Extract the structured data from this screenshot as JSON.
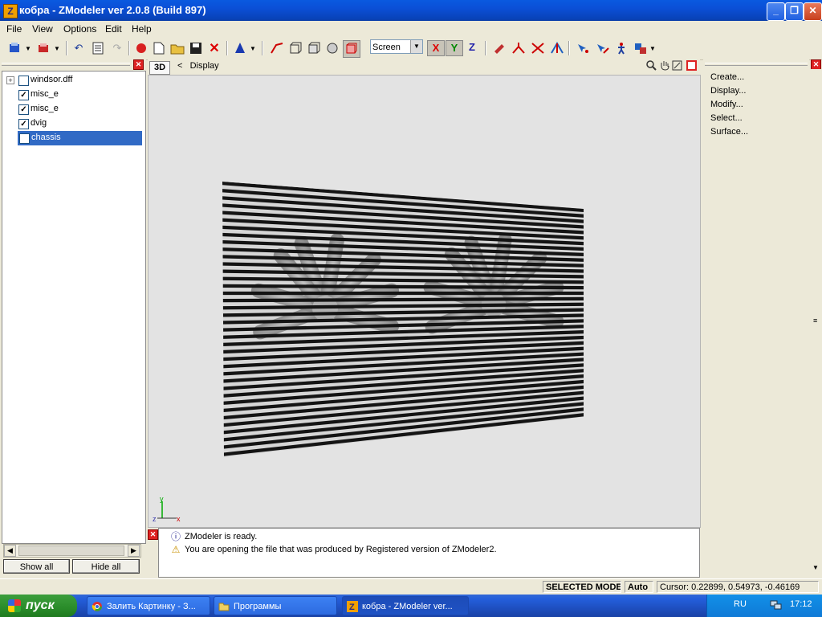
{
  "window": {
    "title": "кобра - ZModeler ver 2.0.8 (Build 897)",
    "app_icon_letter": "Z"
  },
  "caption_buttons": {
    "minimize": "_",
    "maximize": "❐",
    "close": "✕"
  },
  "menu": [
    "File",
    "View",
    "Options",
    "Edit",
    "Help"
  ],
  "toolbar": {
    "space_select": "Screen",
    "axis_x": "X",
    "axis_y": "Y",
    "axis_z": "Z"
  },
  "tree": {
    "items": [
      {
        "label": "windsor.dff",
        "checked": false,
        "expander": "+"
      },
      {
        "label": "misc_e",
        "checked": true
      },
      {
        "label": "misc_e",
        "checked": true
      },
      {
        "label": "dvig",
        "checked": true
      },
      {
        "label": "chassis",
        "checked": false,
        "selected": true
      }
    ]
  },
  "left_buttons": {
    "show_all": "Show all",
    "hide_all": "Hide all"
  },
  "viewport": {
    "mode_button": "3D",
    "nav_arrow": "<",
    "title": "Display",
    "axis_y": "y",
    "axis_z": "z",
    "axis_x": "x"
  },
  "console": {
    "messages": [
      {
        "type": "info",
        "icon": "ⓘ",
        "text": "ZModeler is ready."
      },
      {
        "type": "warning",
        "icon": "⚠",
        "text": "You are opening the file that was produced by Registered version of ZModeler2."
      }
    ]
  },
  "right_panel": {
    "items": [
      "Create...",
      "Display...",
      "Modify...",
      "Select...",
      "Surface..."
    ]
  },
  "statusbar": {
    "mode": "SELECTED MODE",
    "snap": "Auto",
    "cursor": "Cursor: 0.22899, 0.54973, -0.46169"
  },
  "taskbar": {
    "start": "пуск",
    "tasks": [
      "Залить Картинку - З...",
      "Программы",
      "кобра - ZModeler ver..."
    ],
    "lang": "RU",
    "clock": "17:12"
  },
  "colors": {
    "selection": "#316ac5",
    "titlebar": "#0b4fd6",
    "viewport_bg": "#e3e3e3"
  }
}
